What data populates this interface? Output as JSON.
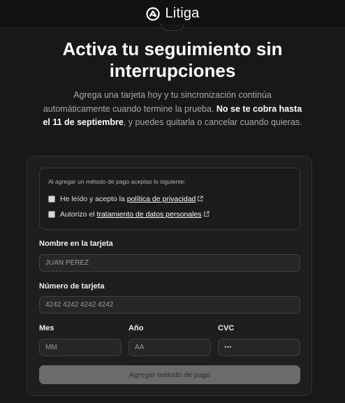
{
  "header": {
    "brand_name": "Litiga",
    "logo_icon": "litiga-logo-icon"
  },
  "hero": {
    "title": "Activa tu seguimiento sin interrupciones",
    "description_1": "Agrega una tarjeta hoy y tu sincronización continúa automáticamente cuando termine la prueba. ",
    "description_bold": "No se te cobra hasta el 11 de septiembre",
    "description_2": ", y puedes quitarla o cancelar cuando quieras."
  },
  "consent": {
    "intro": "Al agregar un método de pago aceptas lo siguiente:",
    "privacy_prefix": "He leído y acepto la ",
    "privacy_link": "política de privacidad",
    "data_prefix": "Autorizo el ",
    "data_link": "tratamiento de datos personales",
    "external_icon": "external-link-icon"
  },
  "form": {
    "name_label": "Nombre en la tarjeta",
    "name_placeholder": "JUAN PÉREZ",
    "card_label": "Número de tarjeta",
    "card_placeholder": "4242 4242 4242 4242",
    "month_label": "Mes",
    "month_placeholder": "MM",
    "year_label": "Año",
    "year_placeholder": "AA",
    "cvc_label": "CVC",
    "cvc_placeholder": "•••",
    "submit_label": "Agregar método de pago"
  },
  "colors": {
    "background": "#181818",
    "topbar": "#111111",
    "card": "#1e1e1e",
    "button_disabled": "#6b6b6b"
  }
}
